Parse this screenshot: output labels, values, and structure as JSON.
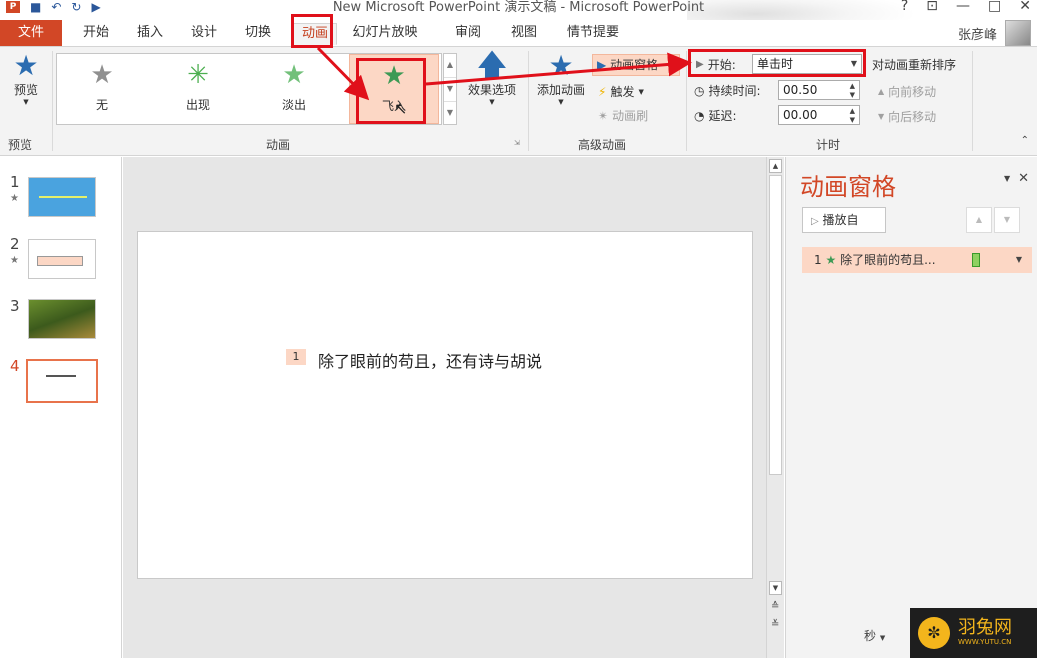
{
  "window": {
    "title": "New Microsoft PowerPoint 演示文稿 - Microsoft PowerPoint",
    "app_logo": "P",
    "controls": [
      "?",
      "⊡",
      "—",
      "□",
      "✕"
    ]
  },
  "tabs": [
    "文件",
    "开始",
    "插入",
    "设计",
    "切换",
    "动画",
    "幻灯片放映",
    "审阅",
    "视图",
    "情节提要"
  ],
  "active_tab": "动画",
  "user": {
    "name": "张彦峰"
  },
  "ribbon": {
    "preview": {
      "label": "预览",
      "group": "预览"
    },
    "animations_group": "动画",
    "gallery": [
      {
        "label": "无",
        "icon": "star-gray-icon"
      },
      {
        "label": "出现",
        "icon": "star-burst-green-icon"
      },
      {
        "label": "淡出",
        "icon": "star-green-icon"
      },
      {
        "label": "飞入",
        "icon": "fly-in-star-icon"
      }
    ],
    "effect_options": "效果选项",
    "add_animation": "添加动画",
    "animation_pane": "动画窗格",
    "trigger": "触发",
    "animation_painter": "动画刷",
    "advanced_group": "高级动画",
    "start_label": "开始:",
    "start_value": "单击时",
    "duration_label": "持续时间:",
    "duration_value": "00.50",
    "delay_label": "延迟:",
    "delay_value": "00.00",
    "reorder_label": "对动画重新排序",
    "move_earlier": "向前移动",
    "move_later": "向后移动",
    "timing_group": "计时"
  },
  "slides": [
    {
      "num": "1",
      "has_anim": true
    },
    {
      "num": "2",
      "has_anim": true
    },
    {
      "num": "3",
      "has_anim": false
    },
    {
      "num": "4",
      "has_anim": false
    }
  ],
  "active_slide": "4",
  "slide": {
    "anim_tag": "1",
    "text": "除了眼前的苟且，还有诗与胡说"
  },
  "animation_pane": {
    "title": "动画窗格",
    "play_from": "播放自",
    "item_num": "1",
    "item_text": "除了眼前的苟且...",
    "seconds": "秒"
  },
  "watermark": {
    "text": "羽兔网",
    "sub": "WWW.YUTU.CN"
  },
  "colors": {
    "accent": "#d24726",
    "highlight": "#e0101a",
    "selection": "#fcd7c5"
  }
}
